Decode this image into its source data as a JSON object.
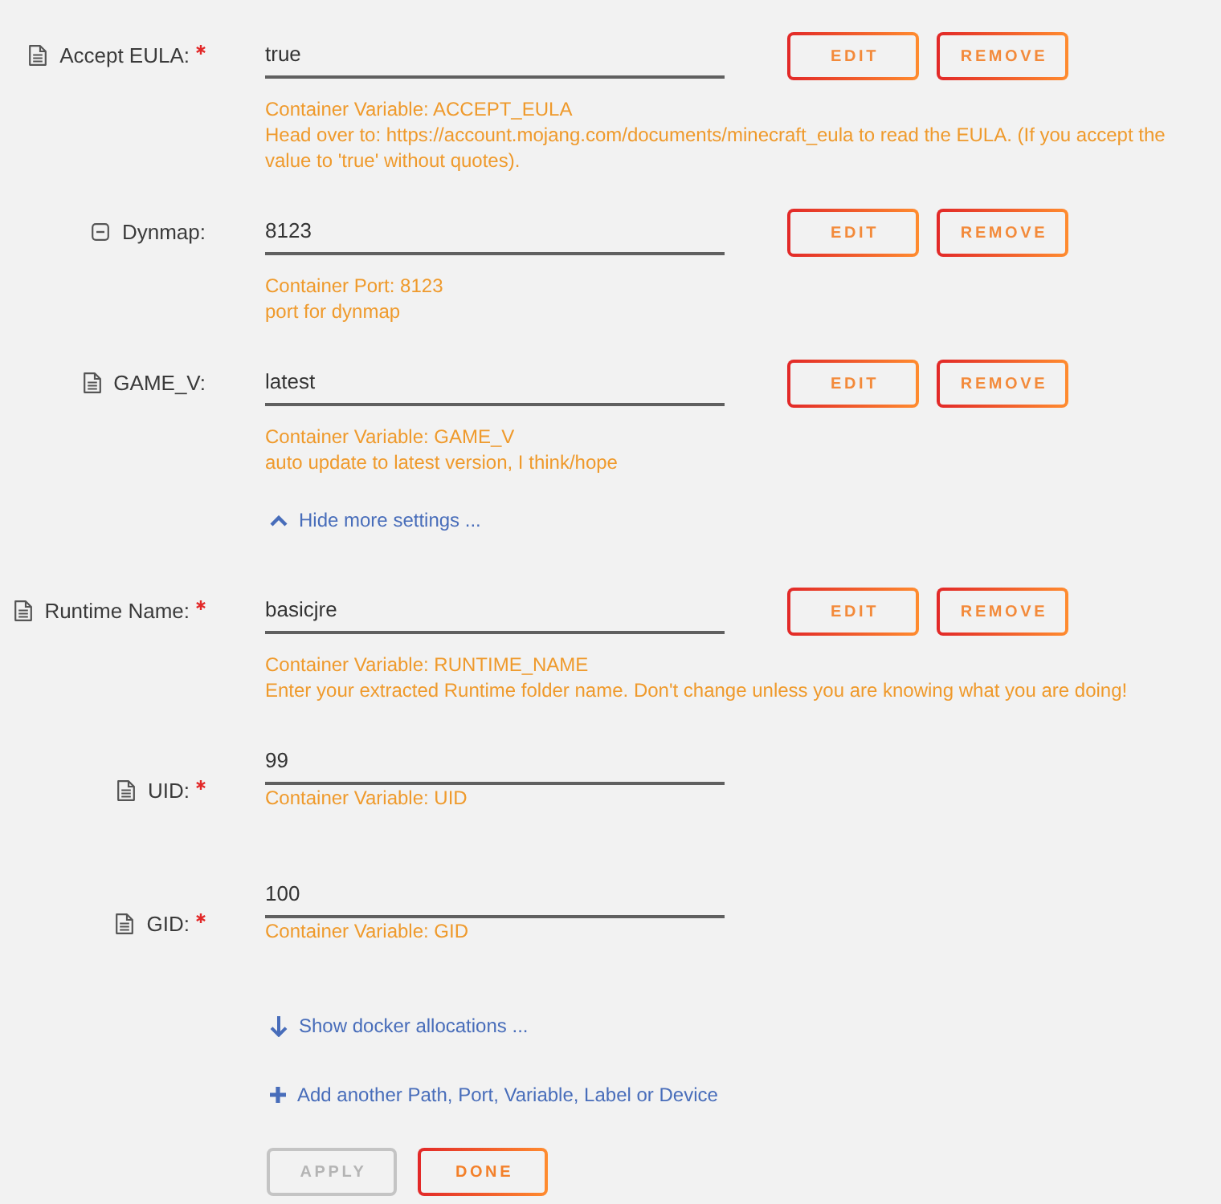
{
  "advanced_fields": [
    {
      "kind": "variable",
      "label": "Accept EULA:",
      "required": true,
      "value": "true",
      "info": "Container Variable: ACCEPT_EULA",
      "description": [
        "Head over to: https://account.mojang.com/documents/minecraft_eula to read the EULA. (If you accept the",
        "value to 'true' without quotes)."
      ],
      "buttons": [
        "EDIT",
        "REMOVE"
      ]
    },
    {
      "kind": "port",
      "label": "Dynmap:",
      "required": false,
      "value": "8123",
      "info": "Container Port: 8123",
      "description": [
        "port for dynmap"
      ],
      "buttons": [
        "EDIT",
        "REMOVE"
      ]
    },
    {
      "kind": "variable",
      "label": "GAME_V:",
      "required": false,
      "value": "latest",
      "info": "Container Variable: GAME_V",
      "description": [
        "auto update to latest version, I think/hope"
      ],
      "buttons": [
        "EDIT",
        "REMOVE"
      ]
    }
  ],
  "advanced_toggle": {
    "label": "Hide more settings ...",
    "expanded": true
  },
  "fields": [
    {
      "kind": "variable",
      "label": "Runtime Name:",
      "required": true,
      "value": "basicjre",
      "info": "Container Variable: RUNTIME_NAME",
      "description": [
        "Enter your extracted Runtime folder name. Don't change unless you are knowing what you are doing!"
      ],
      "buttons": [
        "EDIT",
        "REMOVE"
      ]
    },
    {
      "kind": "variable",
      "label": "UID:",
      "required": true,
      "value": "99",
      "info": "Container Variable: UID"
    },
    {
      "kind": "variable",
      "label": "GID:",
      "required": true,
      "value": "100",
      "info": "Container Variable: GID"
    }
  ],
  "allocations_toggle": {
    "label": "Show docker allocations ...",
    "expanded": false
  },
  "add_link": {
    "label": "Add another Path, Port, Variable, Label or Device"
  },
  "buttons": [
    {
      "label": "APPLY",
      "disabled": true
    },
    {
      "label": "DONE",
      "disabled": false
    }
  ]
}
